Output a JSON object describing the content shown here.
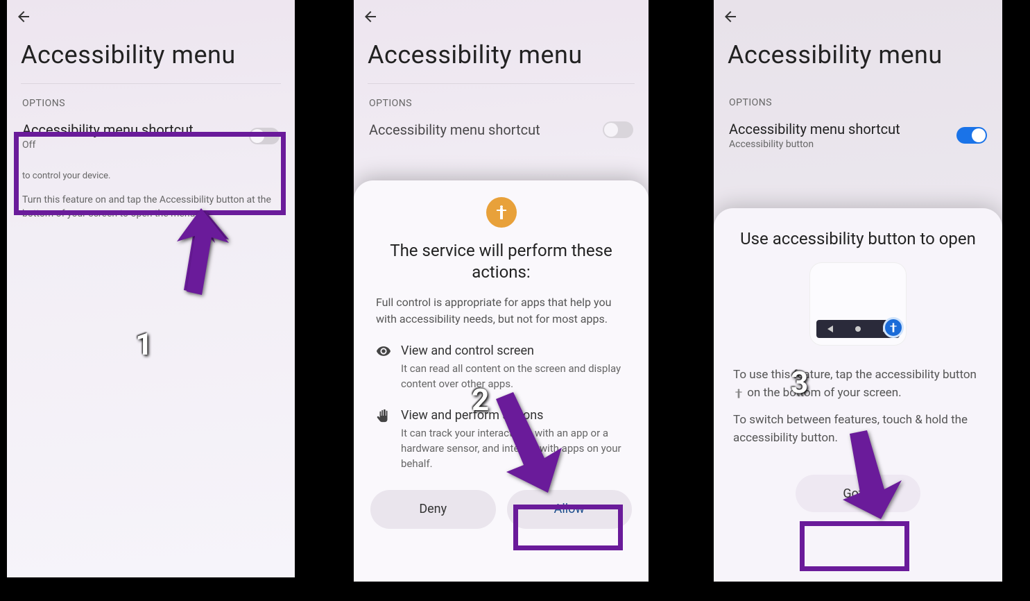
{
  "screen1": {
    "title": "Accessibility menu",
    "section": "OPTIONS",
    "setting_title": "Accessibility menu shortcut",
    "setting_sub": "Off",
    "desc1": "to control your device.",
    "desc2": "Turn this feature on and tap the Accessibility button at the bottom of your screen to open the menu.",
    "step": "1"
  },
  "screen2": {
    "title": "Accessibility menu",
    "section": "OPTIONS",
    "setting_title": "Accessibility menu shortcut",
    "sheet_title": "The service will perform these actions:",
    "sheet_intro": "Full control is appropriate for apps that help you with accessibility needs, but not for most apps.",
    "perm1_title": "View and control screen",
    "perm1_desc": "It can read all content on the screen and display content over other apps.",
    "perm2_title": "View and perform actions",
    "perm2_desc": "It can track your interactions with an app or a hardware sensor, and interact with apps on your behalf.",
    "deny": "Deny",
    "allow": "Allow",
    "step": "2"
  },
  "screen3": {
    "title": "Accessibility menu",
    "section": "OPTIONS",
    "setting_title": "Accessibility menu shortcut",
    "setting_sub": "Accessibility button",
    "sheet_title": "Use accessibility button to open",
    "body1a": "To use this feature, tap the accessibility button ",
    "body1b": " on the bottom of your screen.",
    "body2": "To switch between features, touch & hold the accessibility button.",
    "gotit": "Got it",
    "step": "3"
  },
  "colors": {
    "highlight": "#6a1b9a",
    "toggle_on": "#1a73e8"
  }
}
